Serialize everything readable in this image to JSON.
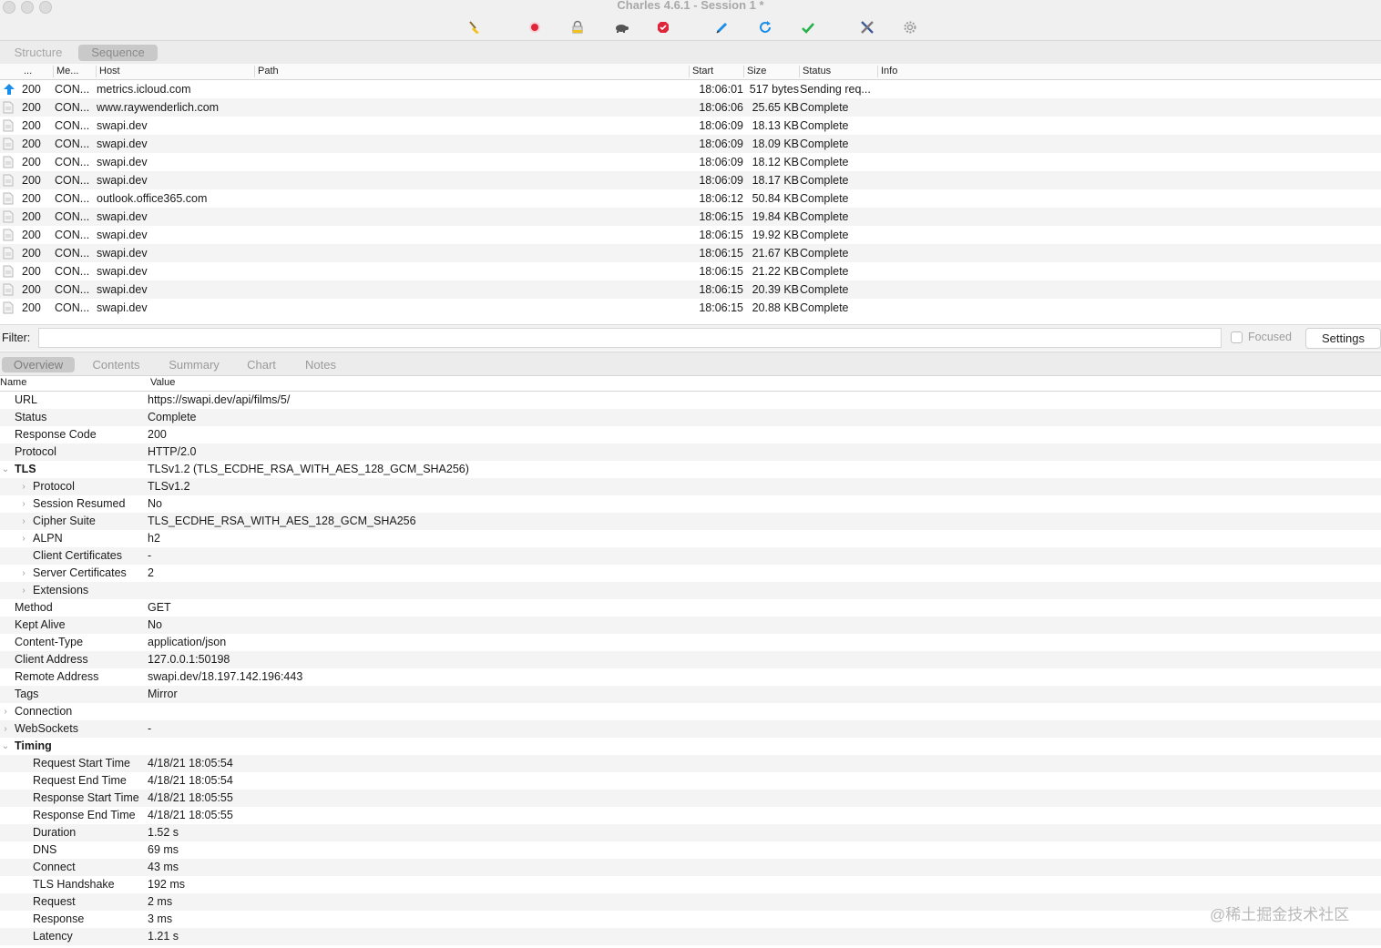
{
  "window": {
    "title": "Charles 4.6.1 - Session 1 *"
  },
  "toolbar": {
    "icons": [
      "broom-icon",
      "record-icon",
      "lock-icon",
      "turtle-icon",
      "breakpoint-icon",
      "pen-icon",
      "refresh-icon",
      "check-icon",
      "tools-icon",
      "gear-icon"
    ]
  },
  "view_tabs": {
    "structure": "Structure",
    "sequence": "Sequence",
    "active": "Sequence"
  },
  "table": {
    "columns": [
      "...",
      "Me...",
      "Host",
      "Path",
      "Start",
      "Size",
      "Status",
      "Info"
    ],
    "rows": [
      {
        "code": "200",
        "method": "CON...",
        "host": "metrics.icloud.com",
        "start": "18:06:01",
        "size": "517 bytes",
        "status": "Sending req..."
      },
      {
        "code": "200",
        "method": "CON...",
        "host": "www.raywenderlich.com",
        "start": "18:06:06",
        "size": "25.65 KB",
        "status": "Complete"
      },
      {
        "code": "200",
        "method": "CON...",
        "host": "swapi.dev",
        "start": "18:06:09",
        "size": "18.13 KB",
        "status": "Complete"
      },
      {
        "code": "200",
        "method": "CON...",
        "host": "swapi.dev",
        "start": "18:06:09",
        "size": "18.09 KB",
        "status": "Complete"
      },
      {
        "code": "200",
        "method": "CON...",
        "host": "swapi.dev",
        "start": "18:06:09",
        "size": "18.12 KB",
        "status": "Complete"
      },
      {
        "code": "200",
        "method": "CON...",
        "host": "swapi.dev",
        "start": "18:06:09",
        "size": "18.17 KB",
        "status": "Complete"
      },
      {
        "code": "200",
        "method": "CON...",
        "host": "outlook.office365.com",
        "start": "18:06:12",
        "size": "50.84 KB",
        "status": "Complete"
      },
      {
        "code": "200",
        "method": "CON...",
        "host": "swapi.dev",
        "start": "18:06:15",
        "size": "19.84 KB",
        "status": "Complete"
      },
      {
        "code": "200",
        "method": "CON...",
        "host": "swapi.dev",
        "start": "18:06:15",
        "size": "19.92 KB",
        "status": "Complete"
      },
      {
        "code": "200",
        "method": "CON...",
        "host": "swapi.dev",
        "start": "18:06:15",
        "size": "21.67 KB",
        "status": "Complete"
      },
      {
        "code": "200",
        "method": "CON...",
        "host": "swapi.dev",
        "start": "18:06:15",
        "size": "21.22 KB",
        "status": "Complete"
      },
      {
        "code": "200",
        "method": "CON...",
        "host": "swapi.dev",
        "start": "18:06:15",
        "size": "20.39 KB",
        "status": "Complete"
      },
      {
        "code": "200",
        "method": "CON...",
        "host": "swapi.dev",
        "start": "18:06:15",
        "size": "20.88 KB",
        "status": "Complete"
      }
    ]
  },
  "filter": {
    "label": "Filter:",
    "value": "",
    "focused_label": "Focused",
    "settings_label": "Settings"
  },
  "detail_tabs": {
    "items": [
      "Overview",
      "Contents",
      "Summary",
      "Chart",
      "Notes"
    ],
    "active": "Overview"
  },
  "props": {
    "col_name": "Name",
    "col_value": "Value",
    "rows": [
      {
        "name": "URL",
        "value": "https://swapi.dev/api/films/5/",
        "level": 0,
        "chev": "",
        "bold": false
      },
      {
        "name": "Status",
        "value": "Complete",
        "level": 0,
        "chev": "",
        "bold": false
      },
      {
        "name": "Response Code",
        "value": "200",
        "level": 0,
        "chev": "",
        "bold": false
      },
      {
        "name": "Protocol",
        "value": "HTTP/2.0",
        "level": 0,
        "chev": "",
        "bold": false
      },
      {
        "name": "TLS",
        "value": "TLSv1.2 (TLS_ECDHE_RSA_WITH_AES_128_GCM_SHA256)",
        "level": 0,
        "chev": "⌄",
        "bold": true
      },
      {
        "name": "Protocol",
        "value": "TLSv1.2",
        "level": 1,
        "chev": "›",
        "bold": false
      },
      {
        "name": "Session Resumed",
        "value": "No",
        "level": 1,
        "chev": "›",
        "bold": false
      },
      {
        "name": "Cipher Suite",
        "value": "TLS_ECDHE_RSA_WITH_AES_128_GCM_SHA256",
        "level": 1,
        "chev": "›",
        "bold": false
      },
      {
        "name": "ALPN",
        "value": "h2",
        "level": 1,
        "chev": "›",
        "bold": false
      },
      {
        "name": "Client Certificates",
        "value": "-",
        "level": 1,
        "chev": "",
        "bold": false
      },
      {
        "name": "Server Certificates",
        "value": "2",
        "level": 1,
        "chev": "›",
        "bold": false
      },
      {
        "name": "Extensions",
        "value": "",
        "level": 1,
        "chev": "›",
        "bold": false
      },
      {
        "name": "Method",
        "value": "GET",
        "level": 0,
        "chev": "",
        "bold": false
      },
      {
        "name": "Kept Alive",
        "value": "No",
        "level": 0,
        "chev": "",
        "bold": false
      },
      {
        "name": "Content-Type",
        "value": "application/json",
        "level": 0,
        "chev": "",
        "bold": false
      },
      {
        "name": "Client Address",
        "value": "127.0.0.1:50198",
        "level": 0,
        "chev": "",
        "bold": false
      },
      {
        "name": "Remote Address",
        "value": "swapi.dev/18.197.142.196:443",
        "level": 0,
        "chev": "",
        "bold": false
      },
      {
        "name": "Tags",
        "value": "Mirror",
        "level": 0,
        "chev": "",
        "bold": false
      },
      {
        "name": "Connection",
        "value": "",
        "level": 0,
        "chev": "›",
        "bold": false
      },
      {
        "name": "WebSockets",
        "value": "-",
        "level": 0,
        "chev": "›",
        "bold": false
      },
      {
        "name": "Timing",
        "value": "",
        "level": 0,
        "chev": "⌄",
        "bold": true
      },
      {
        "name": "Request Start Time",
        "value": "4/18/21 18:05:54",
        "level": 1,
        "chev": "",
        "bold": false
      },
      {
        "name": "Request End Time",
        "value": "4/18/21 18:05:54",
        "level": 1,
        "chev": "",
        "bold": false
      },
      {
        "name": "Response Start Time",
        "value": "4/18/21 18:05:55",
        "level": 1,
        "chev": "",
        "bold": false
      },
      {
        "name": "Response End Time",
        "value": "4/18/21 18:05:55",
        "level": 1,
        "chev": "",
        "bold": false
      },
      {
        "name": "Duration",
        "value": "1.52 s",
        "level": 1,
        "chev": "",
        "bold": false
      },
      {
        "name": "DNS",
        "value": "69 ms",
        "level": 1,
        "chev": "",
        "bold": false
      },
      {
        "name": "Connect",
        "value": "43 ms",
        "level": 1,
        "chev": "",
        "bold": false
      },
      {
        "name": "TLS Handshake",
        "value": "192 ms",
        "level": 1,
        "chev": "",
        "bold": false
      },
      {
        "name": "Request",
        "value": "2 ms",
        "level": 1,
        "chev": "",
        "bold": false
      },
      {
        "name": "Response",
        "value": "3 ms",
        "level": 1,
        "chev": "",
        "bold": false
      },
      {
        "name": "Latency",
        "value": "1.21 s",
        "level": 1,
        "chev": "",
        "bold": false
      }
    ]
  },
  "watermark": "@稀土掘金技术社区",
  "colors": {
    "accent_blue": "#1a8ee8",
    "record_red": "#e0243a",
    "check_green": "#28b24b"
  }
}
